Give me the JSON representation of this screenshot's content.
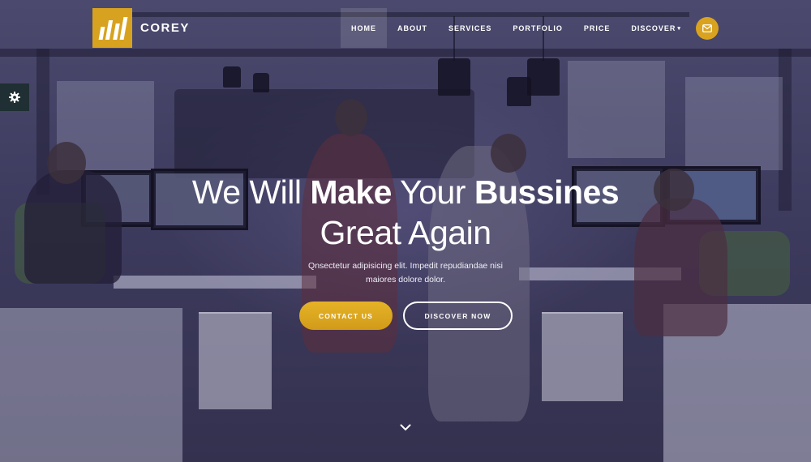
{
  "brand": {
    "name": "COREY",
    "logo_icon": "bars-logo",
    "logo_color": "#d7a21f"
  },
  "nav": {
    "items": [
      {
        "label": "HOME",
        "active": true
      },
      {
        "label": "ABOUT"
      },
      {
        "label": "SERVICES"
      },
      {
        "label": "PORTFOLIO"
      },
      {
        "label": "PRICE"
      },
      {
        "label": "DISCOVER",
        "has_dropdown": true
      }
    ],
    "mail_icon": "envelope-icon",
    "accent": "#d9a31f"
  },
  "settings": {
    "icon": "gear-icon",
    "background": "#1f2f33"
  },
  "hero": {
    "headline": {
      "line1_part1": "We Will ",
      "line1_bold1": "Make",
      "line1_part2": " Your ",
      "line1_bold2": "Bussines",
      "line2": "Great Again"
    },
    "subtext": "Qnsectetur adipisicing elit. Impedit repudiandae nisi maiores dolore dolor.",
    "primary_button": "CONTACT US",
    "secondary_button": "DISCOVER NOW",
    "scroll_icon": "chevron-down-icon"
  }
}
